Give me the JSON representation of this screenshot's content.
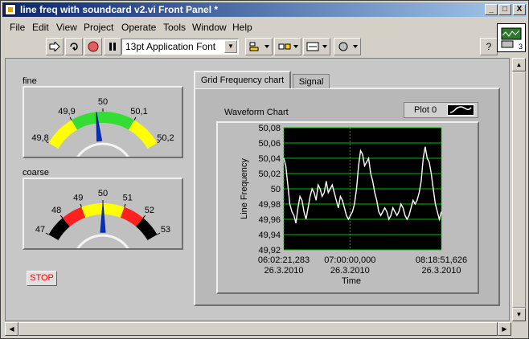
{
  "window": {
    "title": "line freq with soundcard v2.vi Front Panel *",
    "min_label": "_",
    "max_label": "□",
    "close_label": "X"
  },
  "menu": [
    "File",
    "Edit",
    "View",
    "Project",
    "Operate",
    "Tools",
    "Window",
    "Help"
  ],
  "toolbar": {
    "font": "13pt Application Font",
    "help_label": "?"
  },
  "vi_icon": {
    "number": "3"
  },
  "gauge_fine": {
    "label": "fine",
    "ticks": [
      "49,8",
      "49,9",
      "50",
      "50,1",
      "50,2"
    ],
    "value": 49.98
  },
  "gauge_coarse": {
    "label": "coarse",
    "ticks": [
      "47",
      "48",
      "49",
      "50",
      "51",
      "52",
      "53"
    ],
    "value": 50.0
  },
  "stop": {
    "label": "STOP"
  },
  "tabs": [
    "Grid Frequency chart",
    "Signal"
  ],
  "chart_title": "Waveform Chart",
  "legend": {
    "name": "Plot 0"
  },
  "colors": {
    "plot_bg": "#000000",
    "grid": "#00c000",
    "trace": "#ffffff",
    "needle": "#0033cc"
  },
  "chart_data": {
    "type": "line",
    "ylabel": "Line Frequency",
    "xlabel": "Time",
    "ylim": [
      49.92,
      50.08
    ],
    "yticks": [
      "50,08",
      "50,06",
      "50,04",
      "50,02",
      "50",
      "49,98",
      "49,96",
      "49,94",
      "49,92"
    ],
    "xticks": [
      {
        "time": "06:02:21,283",
        "date": "26.3.2010"
      },
      {
        "time": "07:00:00,000",
        "date": "26.3.2010"
      },
      {
        "time": "08:18:51,626",
        "date": "26.3.2010"
      }
    ],
    "xrange": [
      "06:02:21,283",
      "08:18:51,626"
    ],
    "grid": true,
    "series": [
      {
        "values": [
          50.04,
          50.03,
          50.005,
          49.98,
          49.97,
          49.965,
          49.955,
          49.975,
          49.99,
          49.985,
          49.97,
          49.96,
          49.975,
          49.99,
          50.0,
          49.995,
          49.985,
          50.005,
          50.0,
          49.99,
          49.995,
          50.01,
          49.995,
          50.0,
          50.005,
          49.995,
          49.985,
          49.975,
          49.99,
          49.985,
          49.975,
          49.965,
          49.96,
          49.965,
          49.97,
          49.98,
          50.0,
          50.03,
          50.05,
          50.045,
          50.03,
          50.035,
          50.04,
          50.02,
          50.01,
          49.995,
          49.985,
          49.97,
          49.965,
          49.97,
          49.975,
          49.97,
          49.96,
          49.965,
          49.975,
          49.97,
          49.965,
          49.97,
          49.98,
          49.975,
          49.965,
          49.96,
          49.965,
          49.975,
          49.985,
          49.98,
          49.985,
          49.995,
          50.01,
          50.04,
          50.055,
          50.04,
          50.035,
          50.02,
          50.0,
          49.98,
          49.97,
          49.96,
          49.97
        ]
      }
    ]
  }
}
